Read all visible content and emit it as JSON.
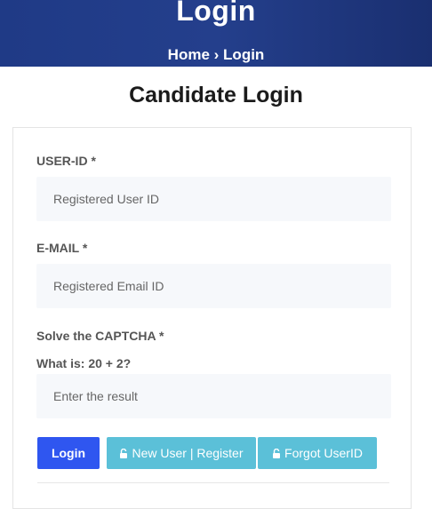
{
  "banner": {
    "title": "Login",
    "breadcrumb_home": "Home",
    "breadcrumb_sep": "›",
    "breadcrumb_current": "Login"
  },
  "page_title": "Candidate Login",
  "form": {
    "userid_label": "USER-ID *",
    "userid_placeholder": "Registered User ID",
    "email_label": "E-MAIL *",
    "email_placeholder": "Registered Email ID",
    "captcha_label": "Solve the CAPTCHA *",
    "captcha_question": "What is: 20 + 2?",
    "captcha_placeholder": "Enter the result"
  },
  "buttons": {
    "login": "Login",
    "register": "New User | Register",
    "forgot": "Forgot UserID"
  },
  "colors": {
    "banner": "#243f8c",
    "login_button": "#2f56f0",
    "secondary_button": "#5bc0d8"
  },
  "icons": {
    "register": "unlock-icon",
    "forgot": "unlock-icon"
  }
}
